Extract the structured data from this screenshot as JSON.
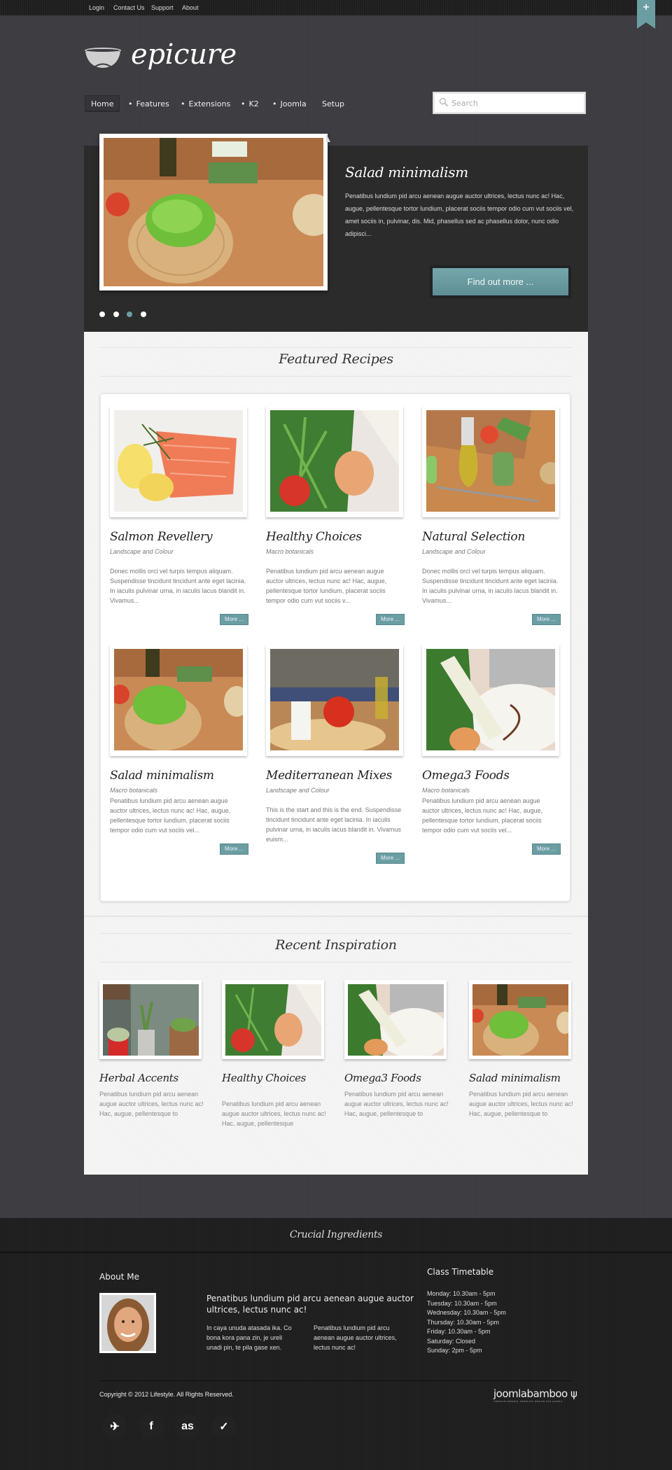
{
  "topbar": {
    "links": [
      "Login",
      "Contact Us",
      "Support",
      "About"
    ],
    "ribbon_icon": "plus-icon",
    "ribbon_symbol": "+"
  },
  "brand": {
    "logo_text": "epicure",
    "logo_icon": "bowl-icon"
  },
  "nav": {
    "items": [
      {
        "label": "Home",
        "active": true
      },
      {
        "label": "Features"
      },
      {
        "label": "Extensions"
      },
      {
        "label": "K2"
      },
      {
        "label": "Joomla"
      },
      {
        "label": "Setup"
      }
    ],
    "bullet": "•"
  },
  "search": {
    "placeholder": "Search",
    "icon": "magnifier-icon"
  },
  "slider": {
    "title": "Salad minimalism",
    "text": "Penatibus lundium pid arcu aenean augue auctor ultrices, lectus nunc ac! Hac, augue, pellentesque tortor lundium, placerat sociis tempor odio cum vut sociis vel, amet sociis in, pulvinar, dis. Mid, phasellus sed ac phasellus dolor, nunc odio adipisci...",
    "button": "Find out more ...",
    "dots": 4,
    "active_dot": 3,
    "accent": "#6b9ea3"
  },
  "featured": {
    "title": "Featured Recipes",
    "more_label": "More ...",
    "cards": [
      {
        "title": "Salmon Revellery",
        "subtitle": "Landscape and Colour",
        "text": "Donec mollis orci vel turpis tempus aliquam. Suspendisse tincidunt tincidunt ante eget lacinia. In iaculis pulvinar urna, in iaculis lacus blandit in. Vivamus...",
        "image": "salmon"
      },
      {
        "title": "Healthy Choices",
        "subtitle": "Macro botanicals",
        "text": "Penatibus lundium pid arcu aenean augue auctor ultrices, lectus nunc ac! Hac, augue, pellentesque tortor lundium, placerat sociis tempor odio cum vut sociis v...",
        "image": "salad-shrimp"
      },
      {
        "title": "Natural Selection",
        "subtitle": "Landscape and Colour",
        "text": "Donec mollis orci vel turpis tempus aliquam. Suspendisse tincidunt tincidunt ante eget lacinia. In iaculis pulvinar urna, in iaculis lacus blandit in. Vivamus...",
        "image": "olive-oil"
      },
      {
        "title": "Salad minimalism",
        "subtitle": "Macro botanicals",
        "text": "Penatibus lundium pid arcu aenean augue auctor ultrices, lectus nunc ac! Hac, augue, pellentesque tortor lundium, placerat sociis tempor odio cum vut sociis vel...",
        "image": "lettuce"
      },
      {
        "title": "Mediterranean Mixes",
        "subtitle": "Landscape and Colour",
        "text": "This is the start and this is the end. Suspendisse tincidunt tincidunt ante eget lacinia. In iaculis pulvinar urna, in iaculis lacus blandit in. Vivamus euism...",
        "image": "tomato-cheese"
      },
      {
        "title": "Omega3 Foods",
        "subtitle": "Macro botanicals",
        "text": "Penatibus lundium pid arcu aenean augue auctor ultrices, lectus nunc ac! Hac, augue, pellentesque tortor lundium, placerat sociis tempor odio cum vut sociis vel...",
        "image": "arugula-plate"
      }
    ]
  },
  "recent": {
    "title": "Recent Inspiration",
    "cards": [
      {
        "title": "Herbal Accents",
        "text": "Penatibus lundium pid arcu aenean augue auctor ultrices, lectus nunc ac! Hac, augue, pellentesque to",
        "image": "herb-pots"
      },
      {
        "title": "Healthy Choices",
        "text": "Penatibus lundium pid arcu aenean augue auctor ultrices, lectus nunc ac! Hac, augue, pellentesque",
        "image": "salad-shrimp"
      },
      {
        "title": "Omega3 Foods",
        "text": "Penatibus lundium pid arcu aenean augue auctor ultrices, lectus nunc ac! Hac, augue, pellentesque to",
        "image": "arugula-plate"
      },
      {
        "title": "Salad minimalism",
        "text": "Penatibus lundium pid arcu aenean augue auctor ultrices, lectus nunc ac! Hac, augue, pellentesque to",
        "image": "lettuce"
      }
    ]
  },
  "footer": {
    "title": "Crucial Ingredients",
    "about_heading": "About Me",
    "lead": "Penatibus lundium pid arcu aenean augue auctor ultrices, lectus nunc ac!",
    "col1": "In caya unuda atasada ika. Co bona kora pana zin, je ureli unadi pin, te pila gase xen.",
    "col2": "Penatibus lundium pid arcu aenean augue auctor ultrices, lectus nunc ac!",
    "timetable_heading": "Class Timetable",
    "timetable": [
      "Monday: 10.30am - 5pm",
      "Tuesday: 10.30am - 5pm",
      "Wednesday: 10.30am - 5pm",
      "Thursday: 10.30am - 5pm",
      "Friday: 10.30am - 5pm",
      "Saturday: Closed",
      "Sunday: 2pm - 5pm"
    ],
    "copyright": "Copyright © 2012 Lifestyle. All Rights Reserved.",
    "brand": "joomlabamboo",
    "brand_tagline": "CREATIVE MINIMAL TEMPLATE DESIGN FOR JOOMLA",
    "social": [
      {
        "name": "twitter",
        "glyph": "✈"
      },
      {
        "name": "facebook",
        "glyph": "f"
      },
      {
        "name": "lastfm",
        "glyph": "as"
      },
      {
        "name": "tweetie",
        "glyph": "✓"
      }
    ]
  }
}
